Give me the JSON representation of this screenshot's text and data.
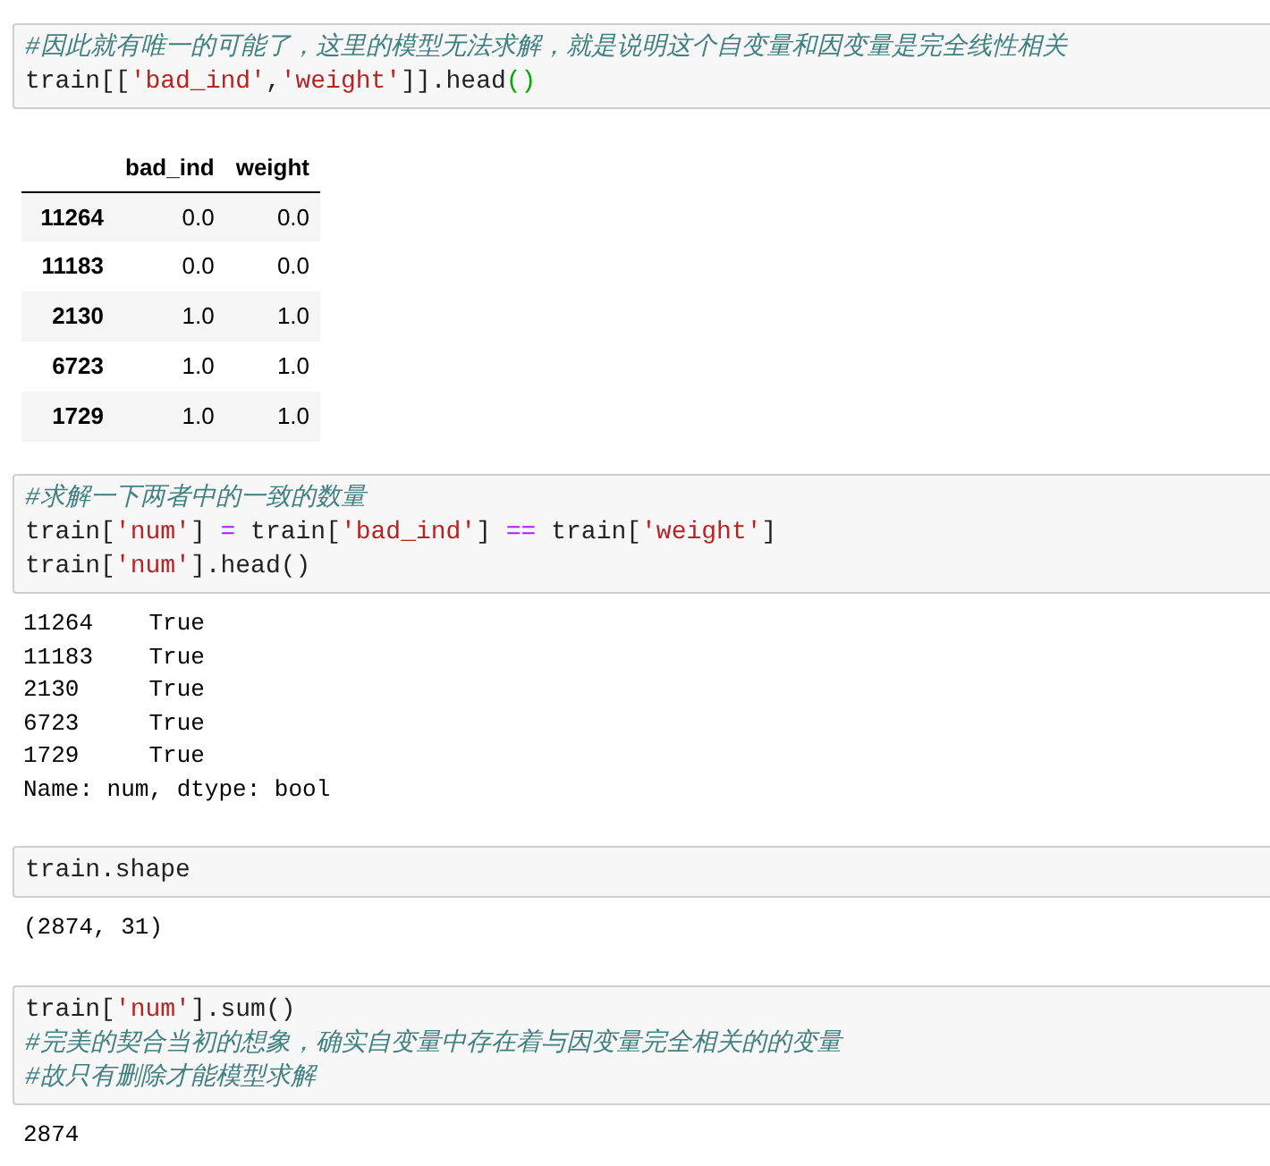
{
  "cells": [
    {
      "input": [
        [
          {
            "kind": "comment",
            "text": "#因此就有唯一的可能了，这里的模型无法求解，就是说明这个自变量和因变量是完全线性相关"
          }
        ],
        [
          {
            "kind": "plain",
            "text": "train[["
          },
          {
            "kind": "string",
            "text": "'bad_ind'"
          },
          {
            "kind": "plain",
            "text": ","
          },
          {
            "kind": "string",
            "text": "'weight'"
          },
          {
            "kind": "plain",
            "text": "]].head"
          },
          {
            "kind": "match",
            "text": "()"
          }
        ]
      ],
      "output": {
        "kind": "table",
        "columns": [
          "bad_ind",
          "weight"
        ],
        "rows": [
          {
            "index": "11264",
            "values": [
              "0.0",
              "0.0"
            ]
          },
          {
            "index": "11183",
            "values": [
              "0.0",
              "0.0"
            ]
          },
          {
            "index": "2130",
            "values": [
              "1.0",
              "1.0"
            ]
          },
          {
            "index": "6723",
            "values": [
              "1.0",
              "1.0"
            ]
          },
          {
            "index": "1729",
            "values": [
              "1.0",
              "1.0"
            ]
          }
        ]
      }
    },
    {
      "input": [
        [
          {
            "kind": "comment",
            "text": "#求解一下两者中的一致的数量"
          }
        ],
        [
          {
            "kind": "plain",
            "text": "train["
          },
          {
            "kind": "string",
            "text": "'num'"
          },
          {
            "kind": "plain",
            "text": "] "
          },
          {
            "kind": "operator",
            "text": "="
          },
          {
            "kind": "plain",
            "text": " train["
          },
          {
            "kind": "string",
            "text": "'bad_ind'"
          },
          {
            "kind": "plain",
            "text": "] "
          },
          {
            "kind": "operator",
            "text": "=="
          },
          {
            "kind": "plain",
            "text": " train["
          },
          {
            "kind": "string",
            "text": "'weight'"
          },
          {
            "kind": "plain",
            "text": "]"
          }
        ],
        [
          {
            "kind": "plain",
            "text": "train["
          },
          {
            "kind": "string",
            "text": "'num'"
          },
          {
            "kind": "plain",
            "text": "].head()"
          }
        ]
      ],
      "output": {
        "kind": "text",
        "lines": [
          "11264    True",
          "11183    True",
          "2130     True",
          "6723     True",
          "1729     True",
          "Name: num, dtype: bool"
        ]
      }
    },
    {
      "input": [
        [
          {
            "kind": "plain",
            "text": "train.shape"
          }
        ]
      ],
      "output": {
        "kind": "text",
        "lines": [
          "(2874, 31)"
        ]
      }
    },
    {
      "input": [
        [
          {
            "kind": "plain",
            "text": "train["
          },
          {
            "kind": "string",
            "text": "'num'"
          },
          {
            "kind": "plain",
            "text": "].sum()"
          }
        ],
        [
          {
            "kind": "comment",
            "text": "#完美的契合当初的想象，确实自变量中存在着与因变量完全相关的的变量"
          }
        ],
        [
          {
            "kind": "comment",
            "text": "#故只有删除才能模型求解"
          }
        ]
      ],
      "output": {
        "kind": "text",
        "lines": [
          "2874"
        ]
      }
    }
  ]
}
